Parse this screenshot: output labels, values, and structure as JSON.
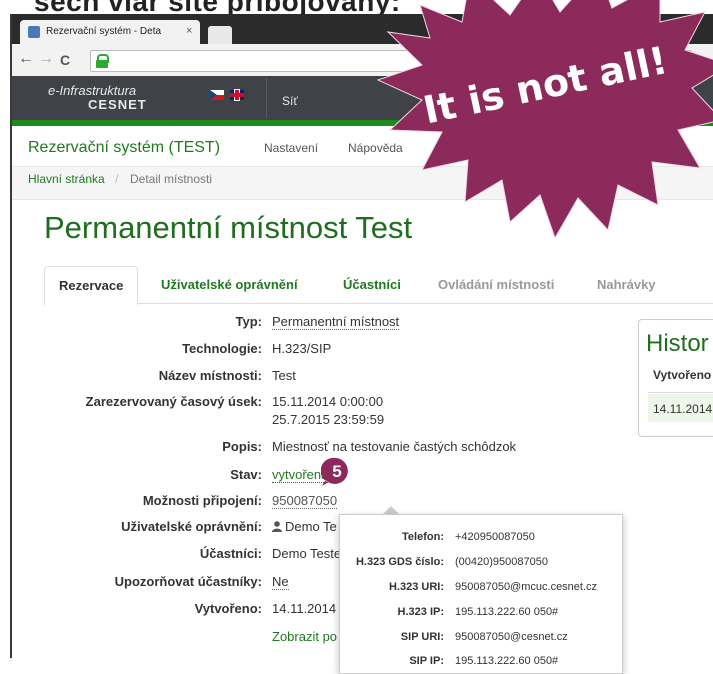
{
  "slide_heading": "šech viár šité příbojovány:",
  "browser": {
    "tab_title": "Rezervační systém - Deta",
    "tab_close": "×",
    "back": "←",
    "forward": "→",
    "reload": "C"
  },
  "cesnet_nav": {
    "brand_line1": "e-Infrastruktura",
    "brand_line2": "CESNET",
    "item_sit": "Síť"
  },
  "app": {
    "title": "Rezervační systém (TEST)",
    "menu_nastaveni": "Nastavení",
    "menu_napoveda": "Nápověda"
  },
  "breadcrumb": {
    "home": "Hlavní stránka",
    "sep": "/",
    "current": "Detail místnosti"
  },
  "page_title": "Permanentní místnost Test",
  "tabs": [
    {
      "label": "Rezervace"
    },
    {
      "label": "Uživatelské oprávnění"
    },
    {
      "label": "Účastníci"
    },
    {
      "label": "Ovládání místnosti"
    },
    {
      "label": "Nahrávky"
    }
  ],
  "details": {
    "typ_label": "Typ:",
    "typ_value": "Permanentní místnost",
    "tech_label": "Technologie:",
    "tech_value": "H.323/SIP",
    "nazev_label": "Název místnosti:",
    "nazev_value": "Test",
    "usek_label": "Zarezervovaný časový úsek:",
    "usek_from": "15.11.2014 0:00:00",
    "usek_to": "25.7.2015 23:59:59",
    "popis_label": "Popis:",
    "popis_value": "Miestnosť na testovanie častých schôdzok",
    "stav_label": "Stav:",
    "stav_value": "vytvořena",
    "moznosti_label": "Možnosti připojení:",
    "moznosti_value": "950087050",
    "opravneni_label": "Uživatelské oprávnění:",
    "opravneni_value": "Demo Te",
    "ucastnici_label": "Účastníci:",
    "ucastnici_value": "Demo Teste",
    "upozornovat_label": "Upozorňovat účastníky:",
    "upozornovat_value": "Ne",
    "vytvoreno_label": "Vytvořeno:",
    "vytvoreno_value": "14.11.2014",
    "zobrazit_link": "Zobrazit po"
  },
  "history": {
    "title": "Histor",
    "col": "Vytvořeno",
    "row": "14.11.2014"
  },
  "popover": {
    "rows": [
      {
        "label": "Telefon:",
        "value": "+420950087050"
      },
      {
        "label": "H.323 GDS číslo:",
        "value": "(00420)950087050"
      },
      {
        "label": "H.323 URI:",
        "value": "950087050@mcuc.cesnet.cz"
      },
      {
        "label": "H.323 IP:",
        "value": "195.113.222.60 050#"
      },
      {
        "label": "SIP URI:",
        "value": "950087050@cesnet.cz"
      },
      {
        "label": "SIP IP:",
        "value": "195.113.222.60 050#"
      }
    ]
  },
  "marker": "5",
  "burst_text": "It is not all!",
  "colors": {
    "brand_green": "#1f7a1f",
    "burst": "#8c2a5c",
    "nav_bg": "#3f4347"
  }
}
